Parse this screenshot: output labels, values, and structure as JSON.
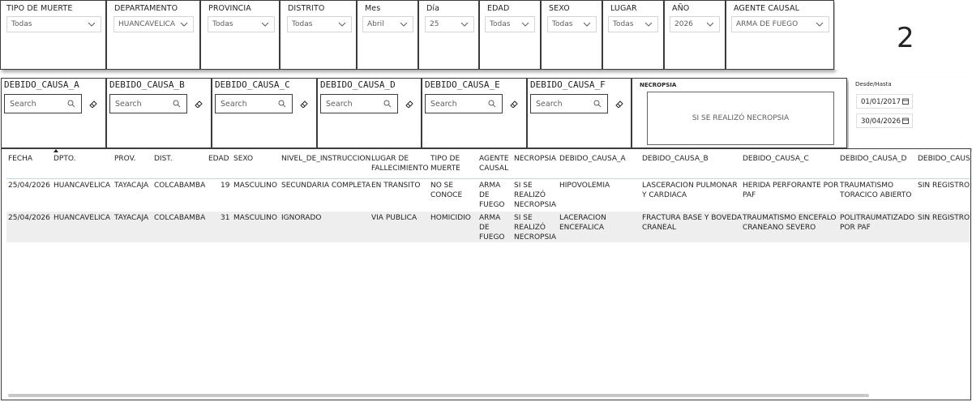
{
  "filters": [
    {
      "key": "tipo_muerte",
      "label": "TIPO DE MUERTE",
      "value": "Todas"
    },
    {
      "key": "departamento",
      "label": "DEPARTAMENTO",
      "value": "HUANCAVELICA"
    },
    {
      "key": "provincia",
      "label": "PROVINCIA",
      "value": "Todas"
    },
    {
      "key": "distrito",
      "label": "DISTRITO",
      "value": "Todas"
    },
    {
      "key": "mes",
      "label": "Mes",
      "value": "Abril"
    },
    {
      "key": "dia",
      "label": "Día",
      "value": "25"
    },
    {
      "key": "edad",
      "label": "EDAD",
      "value": "Todas"
    },
    {
      "key": "sexo",
      "label": "SEXO",
      "value": "Todas"
    },
    {
      "key": "lugar",
      "label": "LUGAR",
      "value": "Todas"
    },
    {
      "key": "anio",
      "label": "AÑO",
      "value": "2026"
    },
    {
      "key": "agente",
      "label": "AGENTE CAUSAL",
      "value": "ARMA DE FUEGO"
    }
  ],
  "card": {
    "value": "2"
  },
  "causa_slicers": [
    {
      "label": "DEBIDO_CAUSA_A",
      "placeholder": "Search"
    },
    {
      "label": "DEBIDO_CAUSA_B",
      "placeholder": "Search"
    },
    {
      "label": "DEBIDO_CAUSA_C",
      "placeholder": "Search"
    },
    {
      "label": "DEBIDO_CAUSA_D",
      "placeholder": "Search"
    },
    {
      "label": "DEBIDO_CAUSA_E",
      "placeholder": "Search"
    },
    {
      "label": "DEBIDO_CAUSA_F",
      "placeholder": "Search"
    }
  ],
  "necropsia": {
    "title": "NECROPSIA",
    "value": "SI SE REALIZÓ NECROPSIA"
  },
  "dates": {
    "title": "Desde/Hasta",
    "from": "01/01/2017",
    "to": "30/04/2026"
  },
  "table": {
    "headers": {
      "fecha": "FECHA",
      "dpto": "DPTO.",
      "prov": "PROV.",
      "dist": "DIST.",
      "edad": "EDAD",
      "sexo": "SEXO",
      "nivel": "NIVEL_DE_INSTRUCCION",
      "lugar_1": "LUGAR DE",
      "lugar_2": "FALLECIMIENTO",
      "tipo_1": "TIPO DE",
      "tipo_2": "MUERTE",
      "agente_1": "AGENTE",
      "agente_2": "CAUSAL",
      "necropsia": "NECROPSIA",
      "causa_a": "DEBIDO_CAUSA_A",
      "causa_b": "DEBIDO_CAUSA_B",
      "causa_c": "DEBIDO_CAUSA_C",
      "causa_d": "DEBIDO_CAUSA_D",
      "causa_e": "DEBIDO_CAUSA"
    },
    "rows": [
      {
        "fecha": "25/04/2026",
        "dpto": "HUANCAVELICA",
        "prov": "TAYACAJA",
        "dist": "COLCABAMBA",
        "edad": "19",
        "sexo": "MASCULINO",
        "nivel": "SECUNDARIA COMPLETA",
        "lugar": "EN TRANSITO",
        "tipo_1": "NO SE",
        "tipo_2": "CONOCE",
        "agente_1": "ARMA",
        "agente_2": "DE",
        "agente_3": "FUEGO",
        "nec_1": "SI SE",
        "nec_2": "REALIZÓ",
        "nec_3": "NECROPSIA",
        "causa_a": "HIPOVOLEMIA",
        "causa_b_1": "LASCERACION PULMONAR",
        "causa_b_2": "Y CARDIACA",
        "causa_c_1": "HERIDA PERFORANTE POR",
        "causa_c_2": "PAF",
        "causa_d_1": "TRAUMATISMO",
        "causa_d_2": "TORACICO ABIERTO",
        "causa_e": "SIN REGISTRO"
      },
      {
        "fecha": "25/04/2026",
        "dpto": "HUANCAVELICA",
        "prov": "TAYACAJA",
        "dist": "COLCABAMBA",
        "edad": "31",
        "sexo": "MASCULINO",
        "nivel": "IGNORADO",
        "lugar": "VIA PUBLICA",
        "tipo_1": "HOMICIDIO",
        "tipo_2": "",
        "agente_1": "ARMA",
        "agente_2": "DE",
        "agente_3": "FUEGO",
        "nec_1": "SI SE",
        "nec_2": "REALIZÓ",
        "nec_3": "NECROPSIA",
        "causa_a_1": "LACERACION",
        "causa_a_2": "ENCEFALICA",
        "causa_b_1": "FRACTURA BASE Y BOVEDA",
        "causa_b_2": "CRANEAL",
        "causa_c_1": "TRAUMATISMO ENCEFALO",
        "causa_c_2": "CRANEANO SEVERO",
        "causa_d_1": "POLITRAUMATIZADO",
        "causa_d_2": "POR PAF",
        "causa_e": "SIN REGISTRO"
      }
    ]
  }
}
